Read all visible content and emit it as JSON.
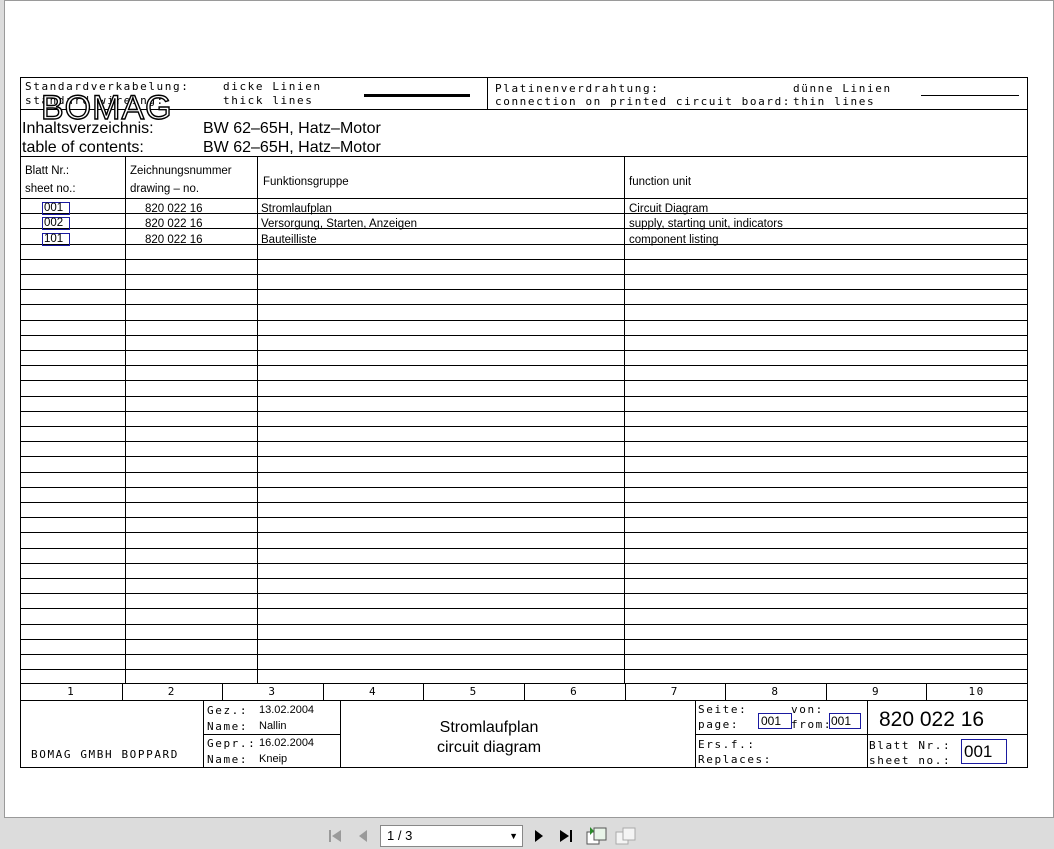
{
  "legend": {
    "std_de": "Standardverkabelung:",
    "std_en": "standard wireing:",
    "thick_de": "dicke Linien",
    "thick_en": "thick lines",
    "pcb_de": "Platinenverdrahtung:",
    "pcb_en": "connection on printed circuit board:",
    "thin_de": "dünne Linien",
    "thin_en": "thin lines"
  },
  "toc": {
    "label_de": "Inhaltsverzeichnis:",
    "label_en": "table of contents:",
    "value_de": "BW 62–65H, Hatz–Motor",
    "value_en": "BW 62–65H, Hatz–Motor"
  },
  "table": {
    "headers": {
      "sheet_de": "Blatt Nr.:",
      "sheet_en": "sheet no.:",
      "drawing_de": "Zeichnungsnummer",
      "drawing_en": "drawing – no.",
      "group": "Funktionsgruppe",
      "unit": "function unit"
    },
    "rows": [
      {
        "sheet": "001",
        "drawing": "820 022 16",
        "group": "Stromlaufplan",
        "unit": "Circuit Diagram"
      },
      {
        "sheet": "002",
        "drawing": "820 022 16",
        "group": "Versorgung, Starten, Anzeigen",
        "unit": "supply, starting unit, indicators"
      },
      {
        "sheet": "101",
        "drawing": "820 022 16",
        "group": "Bauteilliste",
        "unit": "component listing"
      }
    ]
  },
  "columns": [
    "1",
    "2",
    "3",
    "4",
    "5",
    "6",
    "7",
    "8",
    "9",
    "10"
  ],
  "footer": {
    "company": "BOMAG GMBH BOPPARD",
    "logo_text": "BOMAG",
    "drawn_label": "Gez.:",
    "drawn_date": "13.02.2004",
    "name_label": "Name:",
    "drawn_name": "Nallin",
    "checked_label": "Gepr.:",
    "checked_date": "16.02.2004",
    "checked_name": "Kneip",
    "title_de": "Stromlaufplan",
    "title_en": "circuit diagram",
    "page_de": "Seite:",
    "page_en": "page:",
    "page_value": "001",
    "from_de": "von:",
    "from_en": "from:",
    "from_value": "001",
    "replaces_de": "Ers.f.:",
    "replaces_en": "Replaces:",
    "drawing_no": "820 022 16",
    "sheet_de": "Blatt Nr.:",
    "sheet_en": "sheet no.:",
    "sheet_value": "001"
  },
  "viewer": {
    "page_indicator": "1 / 3"
  }
}
